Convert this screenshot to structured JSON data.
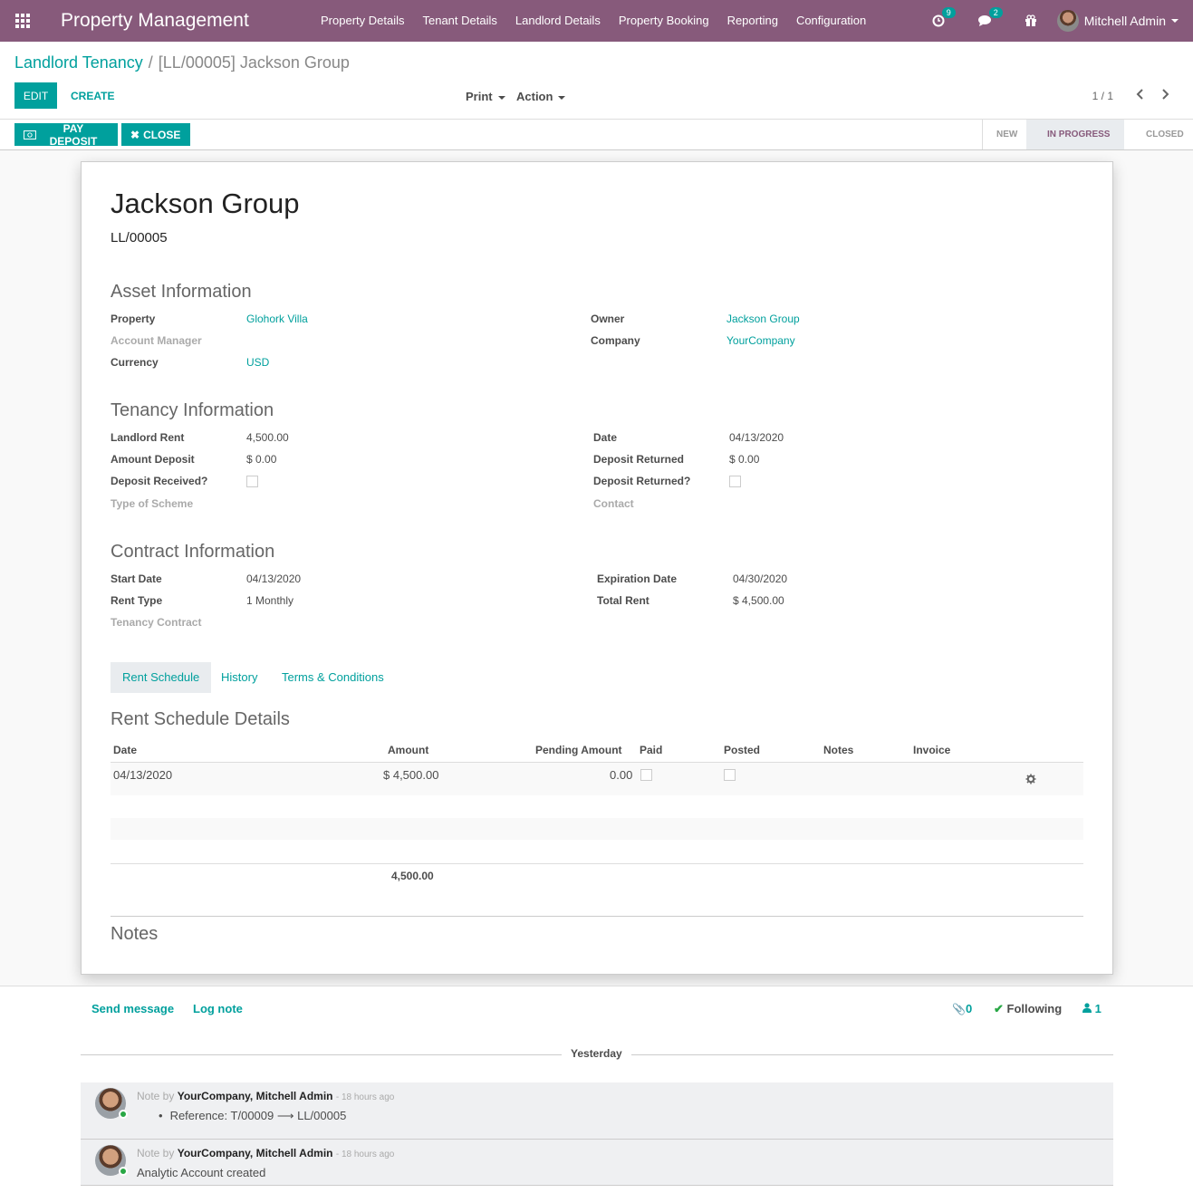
{
  "navbar": {
    "brand": "Property Management",
    "menu": [
      "Property Details",
      "Tenant Details",
      "Landlord Details",
      "Property Booking",
      "Reporting",
      "Configuration"
    ],
    "activity_badge": "9",
    "messages_badge": "2",
    "user_name": "Mitchell Admin",
    "bg_color": "#875a7b"
  },
  "breadcrumb": {
    "parent": "Landlord Tenancy",
    "separator": "/",
    "current": "[LL/00005] Jackson Group"
  },
  "toolbar": {
    "edit_label": "EDIT",
    "create_label": "CREATE",
    "print_label": "Print",
    "action_label": "Action",
    "pager": "1 / 1"
  },
  "status_bar": {
    "pay_deposit_label": "PAY DEPOSIT",
    "close_label": "CLOSE",
    "stages": [
      "NEW",
      "IN PROGRESS",
      "CLOSED"
    ],
    "active_stage": "IN PROGRESS"
  },
  "record": {
    "name": "Jackson Group",
    "reference": "LL/00005"
  },
  "asset_info": {
    "title": "Asset Information",
    "property_label": "Property",
    "property": "Glohork Villa",
    "account_manager_label": "Account Manager",
    "currency_label": "Currency",
    "currency": "USD",
    "owner_label": "Owner",
    "owner": "Jackson Group",
    "company_label": "Company",
    "company": "YourCompany"
  },
  "tenancy_info": {
    "title": "Tenancy Information",
    "landlord_rent_label": "Landlord Rent",
    "landlord_rent": "4,500.00",
    "amount_deposit_label": "Amount Deposit",
    "amount_deposit": "$ 0.00",
    "deposit_received_label": "Deposit Received?",
    "type_of_scheme_label": "Type of Scheme",
    "date_label": "Date",
    "date": "04/13/2020",
    "deposit_returned_amount_label": "Deposit Returned",
    "deposit_returned_amount": "$ 0.00",
    "deposit_returned_check_label": "Deposit Returned?",
    "contact_label": "Contact"
  },
  "contract_info": {
    "title": "Contract Information",
    "start_date_label": "Start Date",
    "start_date": "04/13/2020",
    "rent_type_label": "Rent Type",
    "rent_type": "1 Monthly",
    "tenancy_contract_label": "Tenancy Contract",
    "expiration_date_label": "Expiration Date",
    "expiration_date": "04/30/2020",
    "total_rent_label": "Total Rent",
    "total_rent": "$ 4,500.00"
  },
  "tabs": [
    "Rent Schedule",
    "History",
    "Terms & Conditions"
  ],
  "rent_schedule": {
    "title": "Rent Schedule Details",
    "columns": [
      "Date",
      "Amount",
      "Pending Amount",
      "Paid",
      "Posted",
      "Notes",
      "Invoice"
    ],
    "rows": [
      {
        "date": "04/13/2020",
        "amount": "$ 4,500.00",
        "pending": "0.00"
      }
    ],
    "total": "4,500.00"
  },
  "notes_title": "Notes",
  "chatter": {
    "send_message": "Send message",
    "log_note": "Log note",
    "attachments": "0",
    "following": "Following",
    "followers": "1",
    "day_label": "Yesterday",
    "messages": [
      {
        "prefix": "Note by",
        "author": "YourCompany, Mitchell Admin",
        "ago": "- 18 hours ago",
        "body": "Reference: T/00009 ⟶ LL/00005"
      },
      {
        "prefix": "Note by",
        "author": "YourCompany, Mitchell Admin",
        "ago": "- 18 hours ago",
        "body": "Analytic Account created"
      }
    ]
  }
}
